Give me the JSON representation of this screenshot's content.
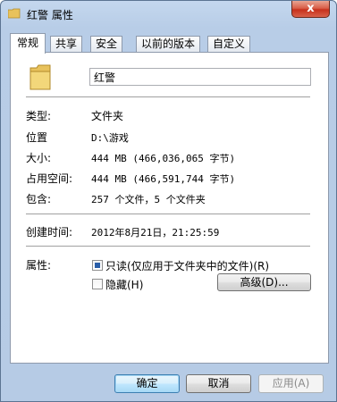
{
  "window": {
    "title": "红警 属性",
    "close_glyph": "x"
  },
  "tabs": [
    {
      "label": "常规",
      "active": true
    },
    {
      "label": "共享",
      "active": false
    },
    {
      "label": "安全",
      "active": false
    },
    {
      "label": "以前的版本",
      "active": false
    },
    {
      "label": "自定义",
      "active": false
    }
  ],
  "general": {
    "name": "红警",
    "type_label": "类型:",
    "type_value": "文件夹",
    "location_label": "位置",
    "location_value": "D:\\游戏",
    "size_label": "大小:",
    "size_value": "444 MB (466,036,065 字节)",
    "size_on_disk_label": "占用空间:",
    "size_on_disk_value": "444 MB (466,591,744 字节)",
    "contains_label": "包含:",
    "contains_value": "257 个文件，5 个文件夹",
    "created_label": "创建时间:",
    "created_value": "2012年8月21日，21:25:59",
    "attributes_label": "属性:",
    "readonly_label": "只读(仅应用于文件夹中的文件)(R)",
    "readonly_checked": true,
    "hidden_label": "隐藏(H)",
    "hidden_checked": false,
    "advanced_button": "高级(D)..."
  },
  "footer": {
    "ok": "确定",
    "cancel": "取消",
    "apply": "应用(A)"
  },
  "colors": {
    "folder": "#e8c25c",
    "accent": "#3c7fb1"
  }
}
